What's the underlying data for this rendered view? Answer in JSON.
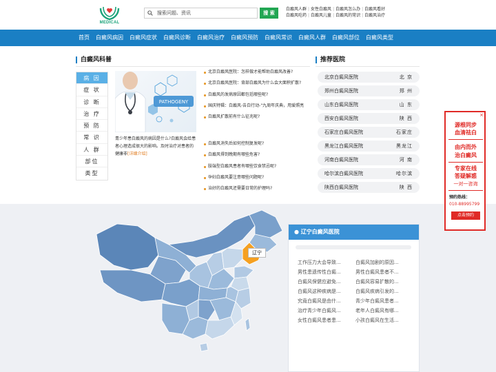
{
  "header": {
    "logo_text": "MEDICAL",
    "search": {
      "placeholder": "搜索问题、资讯",
      "button_label": "搜 索"
    },
    "quick_links": [
      [
        "白癜风人群",
        "女性白癜风",
        "白癜风怎么办",
        "白癜风看好"
      ],
      [
        "白癜风吃药",
        "白癜风儿童",
        "白癜风的常识",
        "白癜风治疗"
      ]
    ]
  },
  "nav": {
    "items": [
      "首页",
      "白癜风病因",
      "白癜风症状",
      "白癜风诊断",
      "白癜风治疗",
      "白癜风预防",
      "白癜风常识",
      "白癜风人群",
      "白癜风部位",
      "白癜风类型"
    ]
  },
  "science": {
    "title": "白癜风科普",
    "categories": [
      "病 因",
      "症 状",
      "诊 断",
      "治 疗",
      "预 防",
      "常 识",
      "人 群",
      "部位",
      "类型"
    ],
    "active_index": 0,
    "image_label": "PATHOGENY",
    "feature_text": "青少年患白癜风的病因是什么?白癜风会给患者心理造成很大的影响。及时治疗对患者的健康非",
    "feature_more": "[详细介绍]",
    "articles_top": [
      "北京白癜风医院：怎样做才能帮助白癜风改善?",
      "北京白癜风医院：背部白癜风为什么会大面积扩散?",
      "白癜风的发病原因都包括哪些呢?",
      "国庆特辑：白癜风-告白行动-\"九周年庆典，用爱照亮",
      "白癜风扩散前有什么征兆呢?"
    ],
    "articles_bottom": [
      "白癜风消失后如何控制复发呢?",
      "白癜风得到晚期有哪些危害?",
      "肢端型白癜风患者有哪些饮食禁忌呢?",
      "孕妇白癜风要注意哪些问题呢?",
      "治好的白癜风还需要日常的护理吗?"
    ]
  },
  "recommend": {
    "title": "推荐医院",
    "hospitals": [
      {
        "name": "北京白癜风医院",
        "city": "北 京"
      },
      {
        "name": "郑州白癜风医院",
        "city": "郑 州"
      },
      {
        "name": "山东白癜风医院",
        "city": "山 东"
      },
      {
        "name": "西安白癜风医院",
        "city": "陕 西"
      },
      {
        "name": "石家庄白癜风医院",
        "city": "石家庄"
      },
      {
        "name": "黑龙江白癜风医院",
        "city": "黑龙江"
      },
      {
        "name": "河南白癜风医院",
        "city": "河 南"
      },
      {
        "name": "哈尔滨白癜风医院",
        "city": "哈尔滨"
      },
      {
        "name": "陕西白癜风医院",
        "city": "陕 西"
      }
    ]
  },
  "ad": {
    "close": "×",
    "line1": "源根同步",
    "line2": "血清祛白",
    "line3": "由内而外",
    "line4": "治白癜风",
    "line5": "专家在线",
    "line6": "答疑解惑",
    "line7": "一对一咨询",
    "tel_label": "预约热线：",
    "tel": "010-88995799",
    "button": "点击预约"
  },
  "map": {
    "highlight_label": "辽宁",
    "card_title": "辽宁白癜风医院",
    "links": [
      "工作压力大会导致...",
      "白癜风加剧的原因...",
      "男性患遗传性白癜...",
      "男性白癜风患者不...",
      "白癜风保健应避免...",
      "白癜风容易扩散的...",
      "白癜风这种疾病是...",
      "白癜风疾病引发的...",
      "究竟白癜风是由什...",
      "青少年白癜风患者...",
      "治疗青少年白癜风...",
      "老年人白癜风有哪...",
      "女性白癜风患者患...",
      "小孩白癜风在生活..."
    ]
  },
  "colors": {
    "nav": "#1a7fc4",
    "accent": "#22a653",
    "ad": "#e02a26",
    "map_dark": "#5b86b8",
    "map_highlight": "#f5a021"
  }
}
